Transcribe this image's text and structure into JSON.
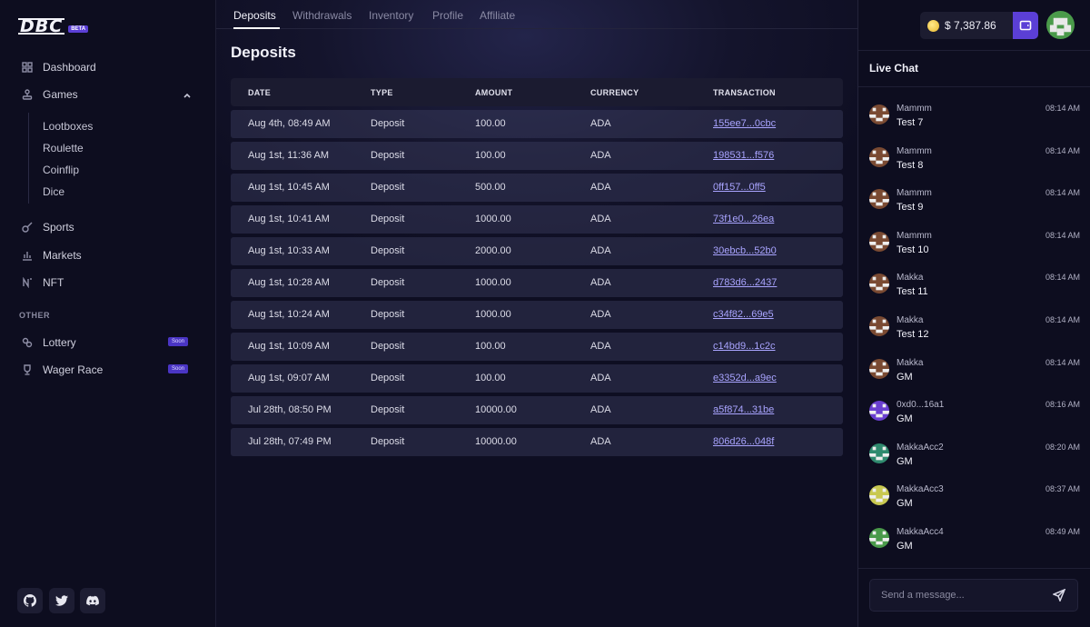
{
  "brand": {
    "logo": "DBC",
    "badge": "BETA"
  },
  "sidebar": {
    "dashboard": "Dashboard",
    "games": "Games",
    "games_items": [
      "Lootboxes",
      "Roulette",
      "Coinflip",
      "Dice"
    ],
    "sports": "Sports",
    "markets": "Markets",
    "nft": "NFT",
    "other_label": "OTHER",
    "lottery": "Lottery",
    "wager_race": "Wager Race",
    "soon_badge": "Soon"
  },
  "tabs": [
    "Deposits",
    "Withdrawals",
    "Inventory",
    "Profile",
    "Affiliate"
  ],
  "page_title": "Deposits",
  "table": {
    "headers": [
      "DATE",
      "TYPE",
      "AMOUNT",
      "CURRENCY",
      "TRANSACTION"
    ],
    "rows": [
      [
        "Aug 4th, 08:49 AM",
        "Deposit",
        "100.00",
        "ADA",
        "155ee7...0cbc"
      ],
      [
        "Aug 1st, 11:36 AM",
        "Deposit",
        "100.00",
        "ADA",
        "198531...f576"
      ],
      [
        "Aug 1st, 10:45 AM",
        "Deposit",
        "500.00",
        "ADA",
        "0ff157...0ff5"
      ],
      [
        "Aug 1st, 10:41 AM",
        "Deposit",
        "1000.00",
        "ADA",
        "73f1e0...26ea"
      ],
      [
        "Aug 1st, 10:33 AM",
        "Deposit",
        "2000.00",
        "ADA",
        "30ebcb...52b0"
      ],
      [
        "Aug 1st, 10:28 AM",
        "Deposit",
        "1000.00",
        "ADA",
        "d783d6...2437"
      ],
      [
        "Aug 1st, 10:24 AM",
        "Deposit",
        "1000.00",
        "ADA",
        "c34f82...69e5"
      ],
      [
        "Aug 1st, 10:09 AM",
        "Deposit",
        "100.00",
        "ADA",
        "c14bd9...1c2c"
      ],
      [
        "Aug 1st, 09:07 AM",
        "Deposit",
        "100.00",
        "ADA",
        "e3352d...a9ec"
      ],
      [
        "Jul 28th, 08:50 PM",
        "Deposit",
        "10000.00",
        "ADA",
        "a5f874...31be"
      ],
      [
        "Jul 28th, 07:49 PM",
        "Deposit",
        "10000.00",
        "ADA",
        "806d26...048f"
      ]
    ]
  },
  "header": {
    "balance": "$ 7,387.86"
  },
  "chat": {
    "title": "Live Chat",
    "messages": [
      {
        "user": "Mammm",
        "time": "08:14 AM",
        "text": "Test 7",
        "avatar_color": "#7a4a32"
      },
      {
        "user": "Mammm",
        "time": "08:14 AM",
        "text": "Test 8",
        "avatar_color": "#7a4a32"
      },
      {
        "user": "Mammm",
        "time": "08:14 AM",
        "text": "Test 9",
        "avatar_color": "#7a4a32"
      },
      {
        "user": "Mammm",
        "time": "08:14 AM",
        "text": "Test 10",
        "avatar_color": "#7a4a32"
      },
      {
        "user": "Makka",
        "time": "08:14 AM",
        "text": "Test 11",
        "avatar_color": "#7a4a32"
      },
      {
        "user": "Makka",
        "time": "08:14 AM",
        "text": "Test 12",
        "avatar_color": "#7a4a32"
      },
      {
        "user": "Makka",
        "time": "08:14 AM",
        "text": "GM",
        "avatar_color": "#7a4a32"
      },
      {
        "user": "0xd0...16a1",
        "time": "08:16 AM",
        "text": "GM",
        "avatar_color": "#6a3fd0"
      },
      {
        "user": "MakkaAcc2",
        "time": "08:20 AM",
        "text": "GM",
        "avatar_color": "#2f8a6e"
      },
      {
        "user": "MakkaAcc3",
        "time": "08:37 AM",
        "text": "GM",
        "avatar_color": "#c8c850"
      },
      {
        "user": "MakkaAcc4",
        "time": "08:49 AM",
        "text": "GM",
        "avatar_color": "#4a9a4a"
      }
    ],
    "input_placeholder": "Send a message..."
  },
  "colors": {
    "accent": "#5b3fd6",
    "link": "#a9a4ff"
  }
}
